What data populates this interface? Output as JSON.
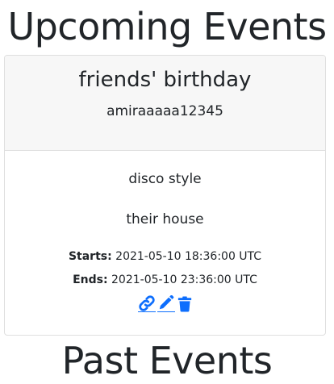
{
  "sections": {
    "upcoming_title": "Upcoming Events",
    "past_title": "Past Events"
  },
  "events": [
    {
      "title": "friends' birthday",
      "user": "amiraaaaa12345",
      "description": "disco style",
      "location": "their house",
      "starts_label": "Starts:",
      "starts_value": "2021-05-10 18:36:00 UTC",
      "ends_label": "Ends:",
      "ends_value": "2021-05-10 23:36:00 UTC",
      "actions": [
        {
          "name": "link",
          "icon": "link-icon"
        },
        {
          "name": "edit",
          "icon": "pencil-icon"
        },
        {
          "name": "delete",
          "icon": "trash-icon"
        }
      ]
    }
  ],
  "colors": {
    "accent": "#0d6efd",
    "header_bg": "#f7f7f7",
    "border": "#dfdfdf",
    "text": "#212529"
  }
}
